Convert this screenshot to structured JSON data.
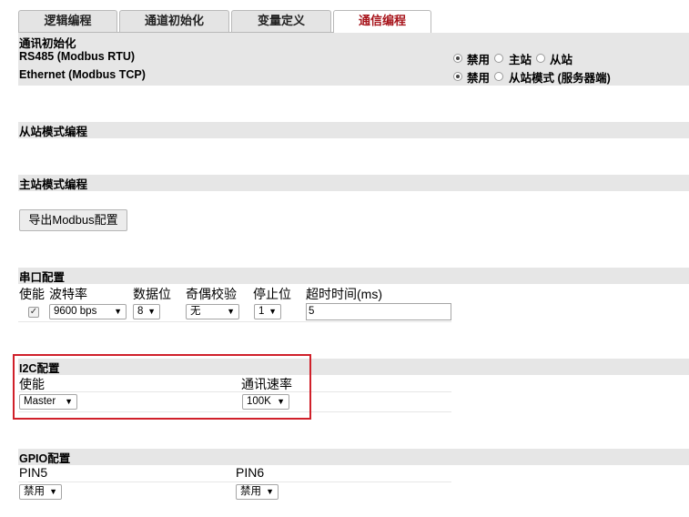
{
  "tabs": [
    "逻辑编程",
    "通道初始化",
    "变量定义",
    "通信编程"
  ],
  "comm_init": {
    "title": "通讯初始化",
    "rs485_label": "RS485 (Modbus RTU)",
    "ethernet_label": "Ethernet (Modbus TCP)",
    "rs485_options": [
      "禁用",
      "主站",
      "从站"
    ],
    "ethernet_options": [
      "禁用",
      "从站模式 (服务器端)"
    ]
  },
  "slave_programming": {
    "title": "从站模式编程"
  },
  "master_programming": {
    "title": "主站模式编程",
    "export_button": "导出Modbus配置"
  },
  "serial_config": {
    "title": "串口配置",
    "headers": [
      "使能",
      "波特率",
      "数据位",
      "奇偶校验",
      "停止位",
      "超时时间(ms)"
    ],
    "enabled_mark": "✓",
    "baud": "9600 bps",
    "data_bits": "8",
    "parity": "无",
    "stop_bits": "1",
    "timeout": "5"
  },
  "i2c_config": {
    "title": "I2C配置",
    "enable_label": "使能",
    "speed_label": "通讯速率",
    "enable_value": "Master",
    "speed_value": "100K"
  },
  "gpio_config": {
    "title": "GPIO配置",
    "pin5_label": "PIN5",
    "pin6_label": "PIN6",
    "pin5_value": "禁用",
    "pin6_value": "禁用"
  },
  "icons": {
    "dropdown": "chevron-down-icon",
    "check": "check-icon"
  }
}
